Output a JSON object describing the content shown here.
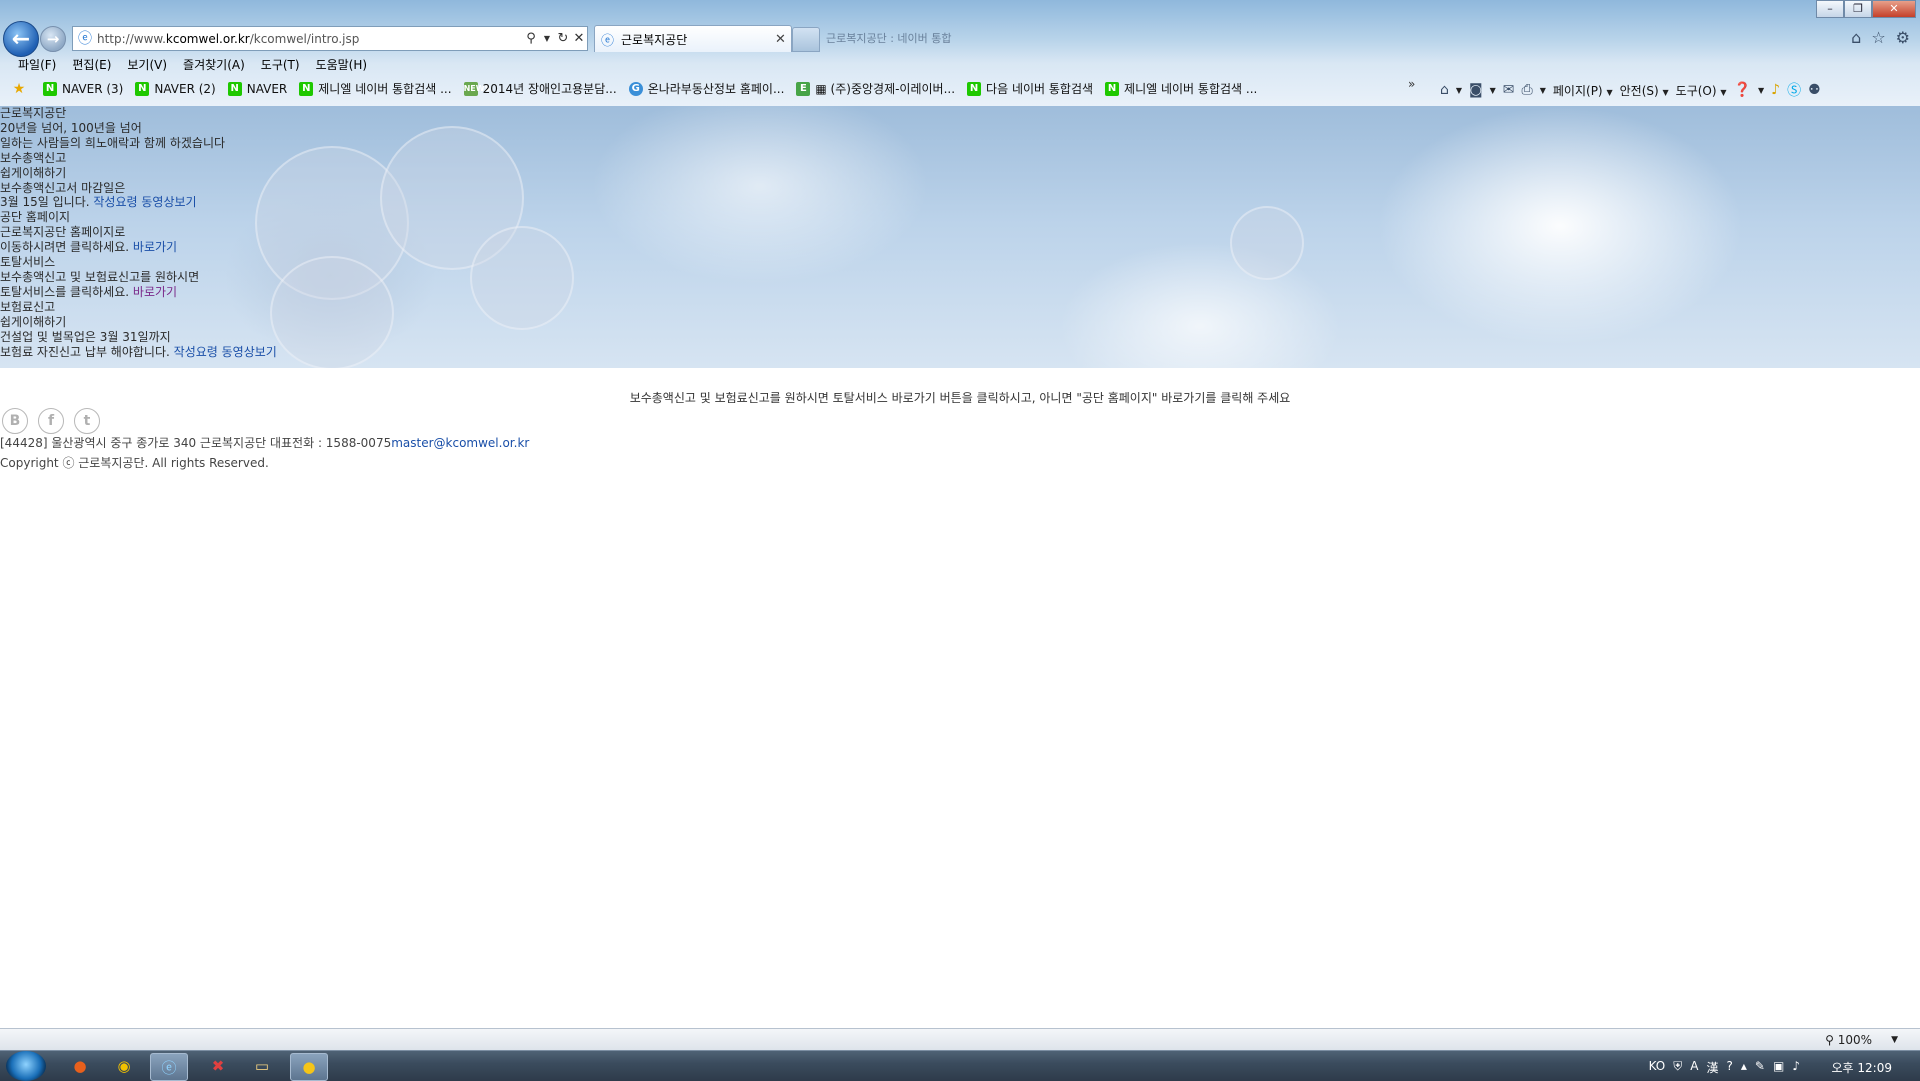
{
  "browser": {
    "url_prefix": "http://www.",
    "url_domain": "kcomwel.or.kr",
    "url_path": "/kcomwel/intro.jsp",
    "active_tab_title": "근로복지공단",
    "inactive_tab_title": "근로복지공단 : 네이버 통합"
  },
  "menubar": [
    "파일(F)",
    "편집(E)",
    "보기(V)",
    "즐겨찾기(A)",
    "도구(T)",
    "도움말(H)"
  ],
  "favorites": [
    {
      "icon": "naver-icon",
      "label": "NAVER (3)"
    },
    {
      "icon": "naver-icon",
      "label": "NAVER (2)"
    },
    {
      "icon": "naver-icon",
      "label": "NAVER"
    },
    {
      "icon": "naver-icon",
      "label": "제니엘  네이버 통합검색 ..."
    },
    {
      "icon": "news-icon",
      "label": "2014년 장애인고용분담..."
    },
    {
      "icon": "globe-icon",
      "label": "온나라부동산정보 홈페이..."
    },
    {
      "icon": "e-icon",
      "label": "▦ (주)중앙경제-이레이버..."
    },
    {
      "icon": "naver-icon",
      "label": "다음  네이버 통합검색"
    },
    {
      "icon": "naver-icon",
      "label": "제니엘  네이버 통합검색 ..."
    }
  ],
  "command_bar": {
    "page": "페이지(P)",
    "safety": "안전(S)",
    "tools": "도구(O)"
  },
  "hero": {
    "l1": "근로복지공단",
    "l2": "20년을 넘어, 100년을 넘어",
    "l3": "일하는 사람들의 희노애락과 함께 하겠습니다",
    "l4": "보수총액신고",
    "l5": "쉽게이해하기",
    "l6": "보수총액신고서 마감일은",
    "l7": "3월 15일 입니다.",
    "l7_link": "작성요령 동영상보기",
    "l8": "공단 홈페이지",
    "l9": "근로복지공단 홈페이지로",
    "l10": "이동하시려면 클릭하세요.",
    "l10_link": "바로가기",
    "l11": "토탈서비스",
    "l12": "보수총액신고 및 보험료신고를 원하시면",
    "l13": "토탈서비스를 클릭하세요.",
    "l13_link": "바로가기",
    "l14": "보험료신고",
    "l15": "쉽게이해하기",
    "l16": "건설업 및 벌목업은 3월 31일까지",
    "l17": "보험료 자진신고 납부 해야합니다.",
    "l17_link": "작성요령 동영상보기"
  },
  "notice": "보수총액신고 및 보험료신고를 원하시면 토탈서비스 바로가기 버튼을 클릭하시고, 아니면 \"공단 홈페이지\" 바로가기를 클릭해 주세요",
  "footer": {
    "sns": [
      "B",
      "f",
      "t"
    ],
    "address": "[44428] 울산광역시 중구 종가로 340 근로복지공단 대표전화 : 1588-0075",
    "email": "master@kcomwel.or.kr",
    "copyright": "Copyright ⓒ 근로복지공단. All rights Reserved."
  },
  "status": {
    "zoom": "100%"
  },
  "taskbar": {
    "lang": "KO",
    "clock": "오후 12:09"
  }
}
